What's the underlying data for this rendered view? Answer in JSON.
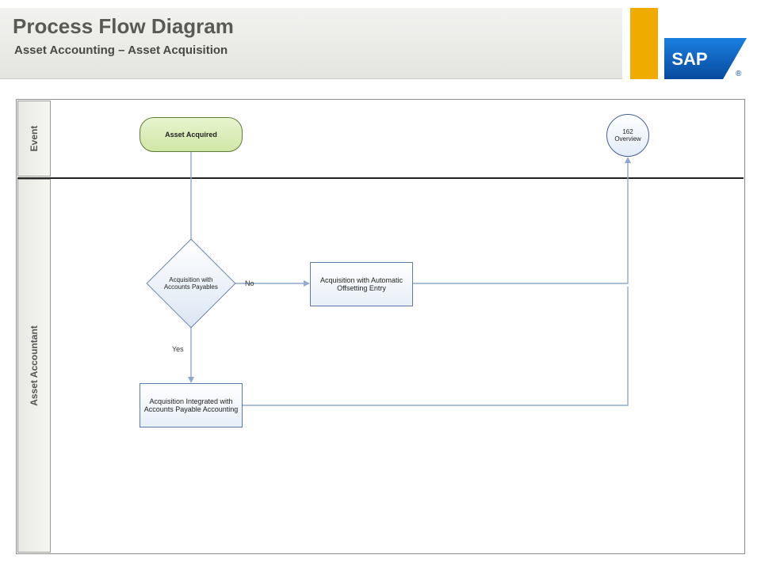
{
  "header": {
    "title": "Process Flow Diagram",
    "subtitle": "Asset Accounting – Asset Acquisition"
  },
  "logo": {
    "text": "SAP"
  },
  "swimlanes": {
    "event": "Event",
    "accountant": "Asset Accountant"
  },
  "shapes": {
    "event_start": "Asset Acquired",
    "overview_line1": "162",
    "overview_line2": "Overview",
    "decision": "Acquisition with Accounts Payables",
    "proc_auto": "Acquisition with Automatic Offsetting Entry",
    "proc_ap": "Acquisition Integrated with Accounts Payable Accounting"
  },
  "labels": {
    "no": "No",
    "yes": "Yes"
  },
  "colors": {
    "accent_gold": "#f0ab00",
    "sap_blue": "#0a6ed1",
    "connector": "#8fa8cf"
  },
  "chart_data": {
    "type": "flowchart",
    "title": "Process Flow Diagram",
    "subtitle": "Asset Accounting – Asset Acquisition",
    "swimlanes": [
      "Event",
      "Asset Accountant"
    ],
    "nodes": [
      {
        "id": "start",
        "lane": "Event",
        "type": "event",
        "label": "Asset Acquired"
      },
      {
        "id": "overview",
        "lane": "Event",
        "type": "subprocess-ref",
        "label": "162 Overview"
      },
      {
        "id": "dec",
        "lane": "Asset Accountant",
        "type": "decision",
        "label": "Acquisition with Accounts Payables"
      },
      {
        "id": "auto",
        "lane": "Asset Accountant",
        "type": "process",
        "label": "Acquisition with Automatic Offsetting Entry"
      },
      {
        "id": "apint",
        "lane": "Asset Accountant",
        "type": "process",
        "label": "Acquisition Integrated with Accounts Payable Accounting"
      }
    ],
    "edges": [
      {
        "from": "start",
        "to": "dec",
        "label": ""
      },
      {
        "from": "dec",
        "to": "auto",
        "label": "No"
      },
      {
        "from": "dec",
        "to": "apint",
        "label": "Yes"
      },
      {
        "from": "auto",
        "to": "overview",
        "label": ""
      },
      {
        "from": "apint",
        "to": "overview",
        "label": ""
      }
    ]
  }
}
